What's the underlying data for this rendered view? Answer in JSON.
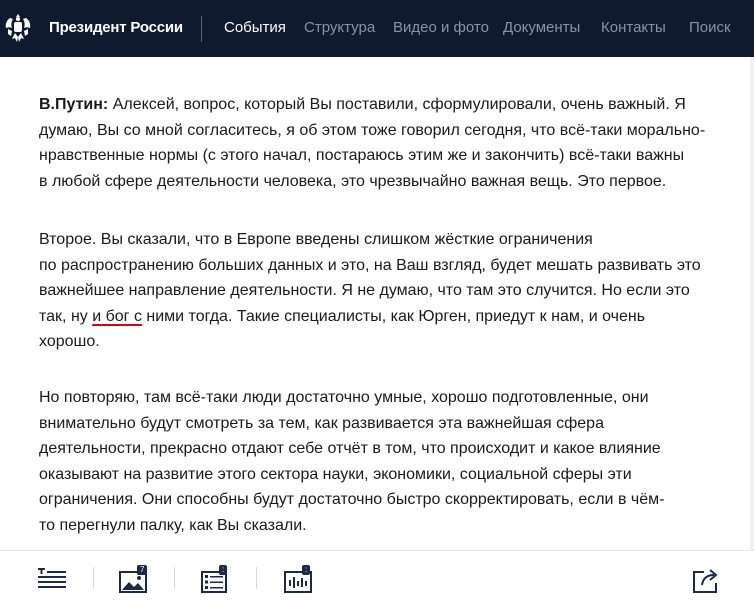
{
  "header": {
    "site_title": "Президент России",
    "nav": [
      {
        "label": "События",
        "active": true
      },
      {
        "label": "Структура",
        "active": false
      },
      {
        "label": "Видео и фото",
        "active": false
      },
      {
        "label": "Документы",
        "active": false
      },
      {
        "label": "Контакты",
        "active": false
      },
      {
        "label": "Поиск",
        "active": false
      }
    ]
  },
  "article": {
    "p1": {
      "speaker": "В.Путин:",
      "lines": [
        " Алексей, вопрос, который Вы поставили, сформулировали, очень важный. Я",
        "думаю, Вы со мной согласитесь, я об этом тоже говорил сегодня, что всё-таки морально-",
        "нравственные нормы (с этого начал, постараюсь этим же и закончить) всё-таки важны",
        "в любой сфере деятельности человека, это чрезвычайно важная вещь. Это первое."
      ]
    },
    "p2": {
      "lines": [
        "Второе. Вы сказали, что в Европе введены слишком жёсткие ограничения",
        "по распространению больших данных и это, на Ваш взгляд, будет мешать развивать это",
        "важнейшее направление деятельности. Я не думаю, что там это случится. Но если это"
      ],
      "line4_pre": "так, ну ",
      "line4_marked": "и бог с",
      "line4_post": " ними тогда. Такие специалисты, как Юрген, приедут к нам, и очень",
      "line5": "хорошо."
    },
    "p3": {
      "lines": [
        "Но повторяю, там всё-таки люди достаточно умные, хорошо подготовленные, они",
        "внимательно будут смотреть за тем, как развивается эта важнейшая сфера",
        "деятельности, прекрасно отдают себе отчёт в том, что происходит и какое влияние",
        "оказывают на развитие этого сектора науки, экономики, социальной сферы эти",
        "ограничения. Они способны будут достаточно быстро скорректировать, если в чём-",
        "то перегнули палку, как Вы сказали."
      ]
    }
  },
  "toolbar": {
    "photos_badge": "7",
    "docs_badge": ":",
    "video_badge": ":",
    "icons": [
      "text-icon",
      "photo-icon",
      "document-icon",
      "video-icon",
      "share-icon"
    ]
  },
  "colors": {
    "header_bg": "#0f1a2e",
    "accent": "#1d2a47",
    "underline": "#d0021b"
  }
}
